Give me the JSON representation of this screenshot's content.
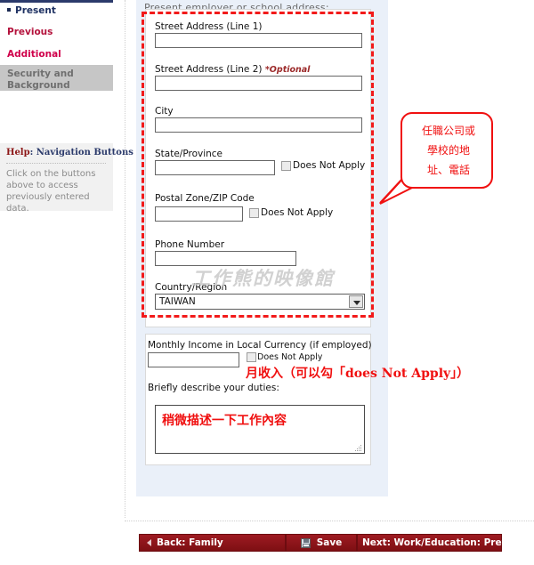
{
  "sidebar": {
    "nav": [
      {
        "key": "present",
        "label": "Present"
      },
      {
        "key": "previous",
        "label": "Previous"
      },
      {
        "key": "additional",
        "label": "Additional"
      },
      {
        "key": "security",
        "label": "Security and Background"
      }
    ],
    "help": {
      "title_word": "Help",
      "title_rest": ": Navigation Buttons",
      "body": "Click on the buttons above to access previously entered data."
    }
  },
  "form": {
    "section_title": "Present employer or school address:",
    "fields": {
      "street1_label": "Street Address (Line 1)",
      "street1_value": "",
      "street2_label": "Street Address (Line 2)",
      "street2_optional": "*Optional",
      "street2_value": "",
      "city_label": "City",
      "city_value": "",
      "state_label": "State/Province",
      "state_value": "",
      "state_dna": "Does Not Apply",
      "postal_label": "Postal Zone/ZIP Code",
      "postal_value": "",
      "postal_dna": "Does Not Apply",
      "phone_label": "Phone Number",
      "phone_value": "",
      "country_label": "Country/Region",
      "country_value": "TAIWAN",
      "income_label": "Monthly Income in Local Currency (if employed)",
      "income_value": "",
      "income_dna": "Does Not Apply",
      "duties_label": "Briefly describe your duties:",
      "duties_value": ""
    }
  },
  "annotations": {
    "bubble_lines": [
      "任職公司或",
      "學校的地",
      "址、電話"
    ],
    "income_note": "月收入（可以勾「does Not Apply」）",
    "duties_note": "稍微描述一下工作內容",
    "watermark": "工作熊的映像館",
    "accent_red": "#f01010"
  },
  "buttons": {
    "back": "Back: Family",
    "save": "Save",
    "next": "Next: Work/Education: Previous"
  }
}
